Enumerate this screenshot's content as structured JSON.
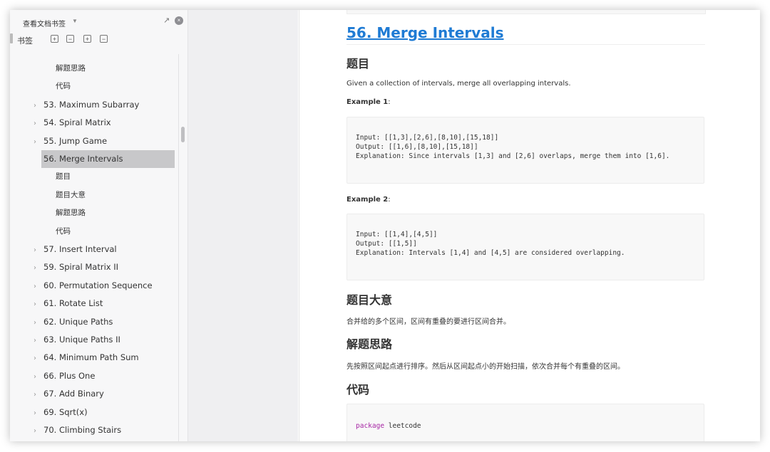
{
  "sidebar": {
    "title": "查看文档书签",
    "tab": "书签",
    "items": [
      {
        "label": "解题思路",
        "level": 2
      },
      {
        "label": "代码",
        "level": 2
      },
      {
        "label": "53. Maximum Subarray",
        "level": 1
      },
      {
        "label": "54. Spiral Matrix",
        "level": 1
      },
      {
        "label": "55. Jump Game",
        "level": 1
      },
      {
        "label": "56. Merge Intervals",
        "level": 1,
        "selected": true
      },
      {
        "label": "题目",
        "level": 2
      },
      {
        "label": "题目大意",
        "level": 2
      },
      {
        "label": "解题思路",
        "level": 2
      },
      {
        "label": "代码",
        "level": 2
      },
      {
        "label": "57. Insert Interval",
        "level": 1
      },
      {
        "label": "59. Spiral Matrix II",
        "level": 1
      },
      {
        "label": "60. Permutation Sequence",
        "level": 1
      },
      {
        "label": "61. Rotate List",
        "level": 1
      },
      {
        "label": "62. Unique Paths",
        "level": 1
      },
      {
        "label": "63. Unique Paths II",
        "level": 1
      },
      {
        "label": "64. Minimum Path Sum",
        "level": 1
      },
      {
        "label": "66. Plus One",
        "level": 1
      },
      {
        "label": "67. Add Binary",
        "level": 1
      },
      {
        "label": "69. Sqrt(x)",
        "level": 1
      },
      {
        "label": "70. Climbing Stairs",
        "level": 1
      }
    ]
  },
  "content": {
    "title": "56. Merge Intervals",
    "section_problem": "题目",
    "problem_text": "Given a collection of intervals, merge all overlapping intervals.",
    "example1_label": "Example 1",
    "example1_code": [
      "Input: [[1,3],[2,6],[8,10],[15,18]]",
      "Output: [[1,6],[8,10],[15,18]]",
      "Explanation: Since intervals [1,3] and [2,6] overlaps, merge them into [1,6]."
    ],
    "example2_label": "Example 2",
    "example2_code": [
      "Input: [[1,4],[4,5]]",
      "Output: [[1,5]]",
      "Explanation: Intervals [1,4] and [4,5] are considered overlapping."
    ],
    "section_summary": "题目大意",
    "summary_text": "合并给的多个区间，区间有重叠的要进行区间合并。",
    "section_approach": "解题思路",
    "approach_text": "先按照区间起点进行排序。然后从区间起点小的开始扫描，依次合并每个有重叠的区间。",
    "section_code": "代码",
    "code_keyword": "package",
    "code_rest": " leetcode"
  }
}
